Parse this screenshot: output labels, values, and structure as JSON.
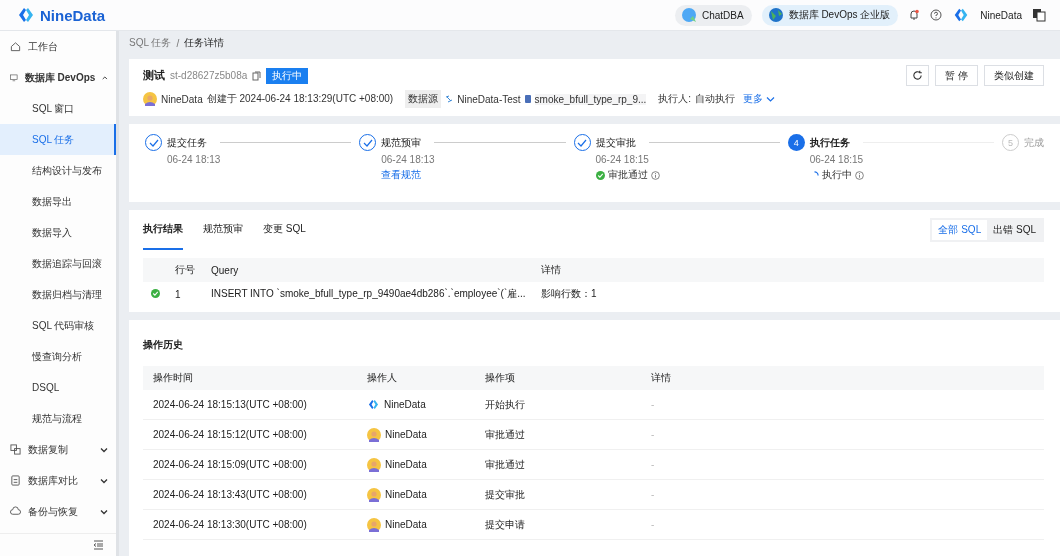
{
  "header": {
    "logo": "NineData",
    "buttons": [
      {
        "label": "ChatDBA",
        "kind": "chat"
      },
      {
        "label": "数据库 DevOps 企业版",
        "kind": "globe"
      }
    ],
    "user": "NineData"
  },
  "sidebar": {
    "items": [
      {
        "label": "工作台",
        "kind": "home",
        "selected": false
      },
      {
        "label": "数据库 DevOps",
        "kind": "monitor",
        "selected": false,
        "expanded": true,
        "children": [
          {
            "label": "SQL 窗口",
            "selected": false
          },
          {
            "label": "SQL 任务",
            "selected": true
          },
          {
            "label": "结构设计与发布",
            "selected": false
          },
          {
            "label": "数据导出",
            "selected": false
          },
          {
            "label": "数据导入",
            "selected": false
          },
          {
            "label": "数据追踪与回滚",
            "selected": false
          },
          {
            "label": "数据归档与清理",
            "selected": false
          },
          {
            "label": "SQL 代码审核",
            "selected": false
          },
          {
            "label": "慢查询分析",
            "selected": false
          },
          {
            "label": "DSQL",
            "selected": false
          },
          {
            "label": "规范与流程",
            "selected": false
          }
        ]
      },
      {
        "label": "数据复制",
        "kind": "copy",
        "selected": false,
        "expanded": false
      },
      {
        "label": "数据库对比",
        "kind": "doc",
        "selected": false,
        "expanded": false
      },
      {
        "label": "备份与恢复",
        "kind": "cloud",
        "selected": false,
        "expanded": false
      }
    ]
  },
  "breadcrumb": {
    "items": [
      "SQL 任务",
      "任务详情"
    ],
    "separator": "/"
  },
  "task": {
    "title": "测试",
    "id": "st-d28627z5b08a",
    "status": "执行中",
    "creator": "NineData",
    "created": "创建于 2024-06-24 18:13:29(UTC +08:00)",
    "source_label": "数据源",
    "source": "NineData-Test",
    "database": "smoke_bfull_type_rp_9...",
    "executor_label": "执行人:",
    "executor": "自动执行",
    "more": "更多",
    "buttons": [
      "暂 停",
      "类似创建"
    ]
  },
  "steps": [
    {
      "label": "提交任务",
      "kind": "done",
      "time": "06-24 18:13"
    },
    {
      "label": "规范预审",
      "kind": "done",
      "time": "06-24 18:13",
      "link": "查看规范"
    },
    {
      "label": "提交审批",
      "kind": "done",
      "time": "06-24 18:15",
      "note": {
        "kind": "passed",
        "text": "审批通过"
      }
    },
    {
      "index": "4",
      "label": "执行任务",
      "kind": "active",
      "time": "06-24 18:15",
      "note": {
        "kind": "running",
        "text": "执行中"
      }
    },
    {
      "index": "5",
      "label": "完成",
      "kind": "waiting"
    }
  ],
  "result_tabs": [
    {
      "label": "执行结果",
      "selected": true
    },
    {
      "label": "规范预审",
      "selected": false
    },
    {
      "label": "变更 SQL",
      "selected": false
    }
  ],
  "filter": [
    {
      "label": "全部 SQL",
      "selected": true
    },
    {
      "label": "出错 SQL",
      "selected": false
    }
  ],
  "results": {
    "columns": [
      "行号",
      "Query",
      "详情"
    ],
    "rows": [
      {
        "success": true,
        "number": "1",
        "query": "INSERT INTO `smoke_bfull_type_rp_9490ae4db286`.`employee`(`雇...",
        "detail": "影响行数：1"
      }
    ]
  },
  "history": {
    "title": "操作历史",
    "columns": [
      "操作时间",
      "操作人",
      "操作项",
      "详情"
    ],
    "rows": [
      {
        "time": "2024-06-24 18:15:13(UTC +08:00)",
        "operator": "NineData",
        "kind": "logo",
        "action": "开始执行",
        "detail": "-"
      },
      {
        "time": "2024-06-24 18:15:12(UTC +08:00)",
        "operator": "NineData",
        "kind": "avatar",
        "action": "审批通过",
        "detail": "-"
      },
      {
        "time": "2024-06-24 18:15:09(UTC +08:00)",
        "operator": "NineData",
        "kind": "avatar",
        "action": "审批通过",
        "detail": "-"
      },
      {
        "time": "2024-06-24 18:13:43(UTC +08:00)",
        "operator": "NineData",
        "kind": "avatar",
        "action": "提交审批",
        "detail": "-"
      },
      {
        "time": "2024-06-24 18:13:30(UTC +08:00)",
        "operator": "NineData",
        "kind": "avatar",
        "action": "提交申请",
        "detail": "-"
      }
    ]
  }
}
